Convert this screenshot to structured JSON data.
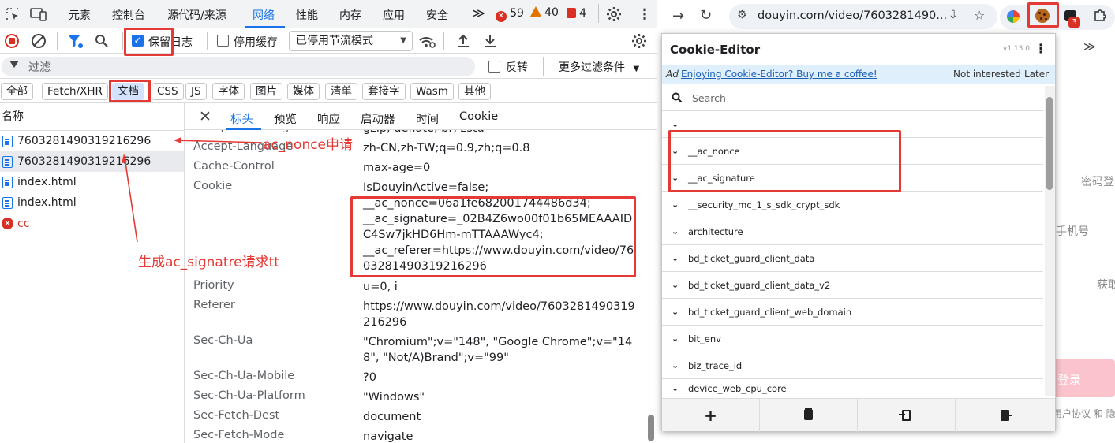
{
  "devtools": {
    "tabs": [
      "元素",
      "控制台",
      "源代码/来源",
      "网络",
      "性能",
      "内存",
      "应用",
      "安全"
    ],
    "active_tab": "网络",
    "more_tabs": "≫",
    "errors_count": "59",
    "warnings_count": "40",
    "issues_count": "4",
    "toolbar": {
      "preserve_log_label": "保留日志",
      "preserve_log_checked": true,
      "disable_cache_label": "停用缓存",
      "throttle_value": "已停用节流模式"
    },
    "filter": {
      "placeholder": "过滤",
      "invert_label": "反转",
      "more_filters_label": "更多过滤条件"
    },
    "type_filters": [
      "全部",
      "Fetch/XHR",
      "文档",
      "CSS",
      "JS",
      "字体",
      "图片",
      "媒体",
      "清单",
      "套接字",
      "Wasm",
      "其他"
    ],
    "active_type": "文档",
    "list_header": "名称",
    "requests": [
      {
        "name": "7603281490319216296",
        "type": "doc"
      },
      {
        "name": "7603281490319216296",
        "type": "doc"
      },
      {
        "name": "index.html",
        "type": "doc"
      },
      {
        "name": "index.html",
        "type": "doc"
      },
      {
        "name": "cc",
        "type": "error"
      }
    ],
    "detail_tabs": [
      "标头",
      "预览",
      "响应",
      "启动器",
      "时间",
      "Cookie"
    ],
    "active_detail_tab": "标头",
    "headers": [
      {
        "name": "Accept-Encoding",
        "value": "gzip, deflate, br, zstd"
      },
      {
        "name": "Accept-Language",
        "value": "zh-CN,zh-TW;q=0.9,zh;q=0.8"
      },
      {
        "name": "Cache-Control",
        "value": "max-age=0"
      },
      {
        "name": "Cookie",
        "value": "IsDouyinActive=false;"
      },
      {
        "name": "",
        "value": "__ac_nonce=06a1fe682001744486d34;"
      },
      {
        "name": "",
        "value": "__ac_signature=_02B4Z6wo00f01b65MEAAAIDC4Sw7jkHD6Hm-mTTAAAWyc4;"
      },
      {
        "name": "",
        "value": "__ac_referer=https://www.douyin.com/video/7603281490319216296"
      },
      {
        "name": "Priority",
        "value": "u=0, i"
      },
      {
        "name": "Referer",
        "value": "https://www.douyin.com/video/7603281490319216296"
      },
      {
        "name": "Sec-Ch-Ua",
        "value": "\"Chromium\";v=\"148\", \"Google Chrome\";v=\"148\", \"Not/A)Brand\";v=\"99\""
      },
      {
        "name": "Sec-Ch-Ua-Mobile",
        "value": "?0"
      },
      {
        "name": "Sec-Ch-Ua-Platform",
        "value": "\"Windows\""
      },
      {
        "name": "Sec-Fetch-Dest",
        "value": "document"
      },
      {
        "name": "Sec-Fetch-Mode",
        "value": "navigate"
      }
    ]
  },
  "annotations": {
    "nonce_note": "ac_nonce申请",
    "signature_note": "生成ac_signatre请求tt"
  },
  "browser": {
    "url": "douyin.com/video/7603281490...",
    "extension_badge": "3",
    "page_texts": {
      "password_login": "密码登",
      "phone": "手机号",
      "get": "获取",
      "login": "登录",
      "agreement": "用户协议 和 隐"
    }
  },
  "cookie_editor": {
    "title": "Cookie-Editor",
    "version": "v1.13.0",
    "ad_tag": "Ad",
    "ad_text": "Enjoying Cookie-Editor? Buy me a coffee!",
    "not_interested": "Not interested",
    "later": "Later",
    "search_placeholder": "Search",
    "cookies": [
      "",
      "__ac_nonce",
      "__ac_signature",
      "__security_mc_1_s_sdk_crypt_sdk",
      "architecture",
      "bd_ticket_guard_client_data",
      "bd_ticket_guard_client_data_v2",
      "bd_ticket_guard_client_web_domain",
      "bit_env",
      "biz_trace_id",
      "device_web_cpu_core"
    ],
    "footer_buttons": [
      "add",
      "delete",
      "import",
      "export"
    ]
  },
  "colors": {
    "accent": "#1a73e8",
    "annotation_red": "#e53935"
  }
}
